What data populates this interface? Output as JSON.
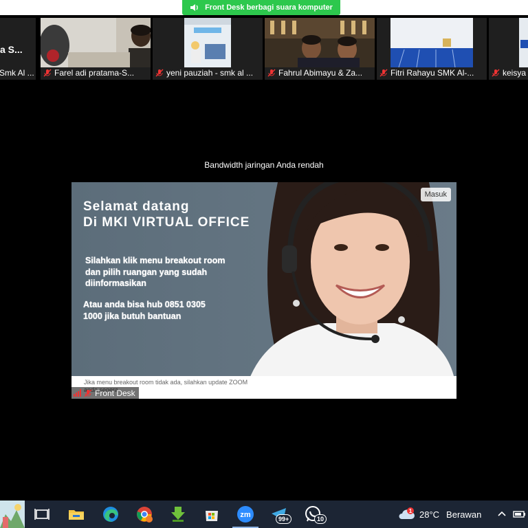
{
  "banner": {
    "text": "Front Desk berbagi suara komputer",
    "color": "#2dc84d",
    "icon": "speaker-icon"
  },
  "participants": [
    {
      "name": "Smk Al ...",
      "overlay": "a S..."
    },
    {
      "name": "Farel adi pratama-S..."
    },
    {
      "name": "yeni pauziah - smk al ..."
    },
    {
      "name": "Fahrul Abimayu & Za..."
    },
    {
      "name": "Fitri Rahayu SMK Al-..."
    },
    {
      "name": "keisya"
    }
  ],
  "main": {
    "bandwidth_message": "Bandwidth jaringan Anda rendah",
    "slide": {
      "title_line1": "Selamat datang",
      "title_line2": "Di MKI VIRTUAL OFFICE",
      "para1_line1": "Silahkan klik menu breakout room",
      "para1_line2": "dan pilih ruangan yang sudah",
      "para1_line3": "diinformasikan",
      "para2_line1": "Atau anda bisa hub 0851 0305",
      "para2_line2": "1000 jika butuh bantuan",
      "footer_line1": "Jika menu breakout room tidak ada, silahkan update ZOOM",
      "footer_line2": "anda segera"
    },
    "masuk_button": "Masuk",
    "speaker_name": "Front Desk"
  },
  "taskbar": {
    "apps": [
      "task-view",
      "file-explorer",
      "edge",
      "chrome",
      "idm",
      "microsoft-store",
      "zoom",
      "telegram",
      "whatsapp"
    ],
    "telegram_badge": "99+",
    "whatsapp_badge": "10",
    "weather": {
      "temp": "28°C",
      "condition": "Berawan",
      "alert": "1"
    }
  }
}
